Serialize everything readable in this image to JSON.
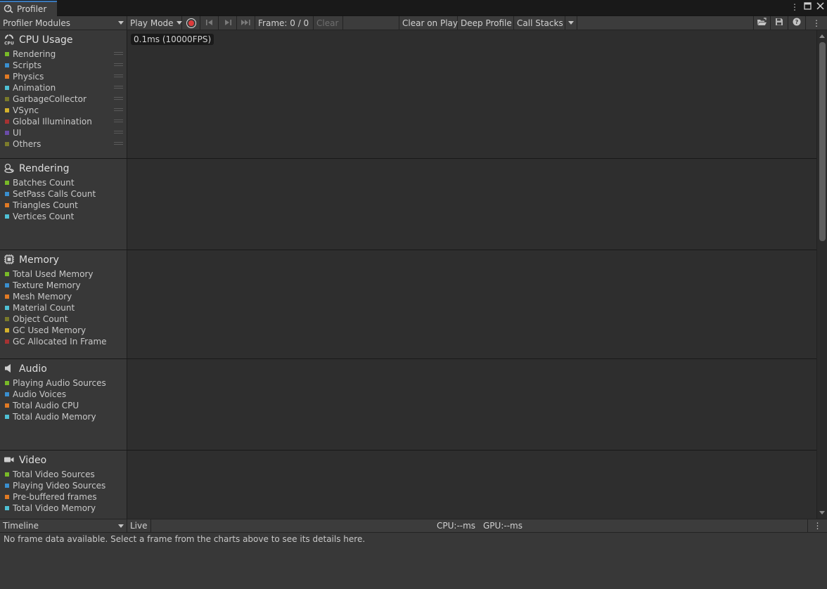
{
  "window": {
    "tab_title": "Profiler"
  },
  "toolbar": {
    "modules_dropdown": "Profiler Modules",
    "target_dropdown": "Play Mode",
    "frame": "Frame: 0 / 0",
    "clear": "Clear",
    "clear_on_play": "Clear on Play",
    "deep_profile": "Deep Profile",
    "call_stacks": "Call Stacks"
  },
  "modules": [
    {
      "title": "CPU Usage",
      "icon": "cpu-icon",
      "chart_label": "0.1ms (10000FPS)",
      "items": [
        {
          "label": "Rendering",
          "color": "#79b928"
        },
        {
          "label": "Scripts",
          "color": "#3a8fcf"
        },
        {
          "label": "Physics",
          "color": "#e07a24"
        },
        {
          "label": "Animation",
          "color": "#4fc0d4"
        },
        {
          "label": "GarbageCollector",
          "color": "#7a7a2a"
        },
        {
          "label": "VSync",
          "color": "#d4b22c"
        },
        {
          "label": "Global Illumination",
          "color": "#a63232"
        },
        {
          "label": "UI",
          "color": "#6a4ca8"
        },
        {
          "label": "Others",
          "color": "#7c7c2c"
        }
      ]
    },
    {
      "title": "Rendering",
      "icon": "rendering-icon",
      "items": [
        {
          "label": "Batches Count",
          "color": "#79b928"
        },
        {
          "label": "SetPass Calls Count",
          "color": "#3a8fcf"
        },
        {
          "label": "Triangles Count",
          "color": "#e07a24"
        },
        {
          "label": "Vertices Count",
          "color": "#4fc0d4"
        }
      ]
    },
    {
      "title": "Memory",
      "icon": "memory-chip-icon",
      "items": [
        {
          "label": "Total Used Memory",
          "color": "#79b928"
        },
        {
          "label": "Texture Memory",
          "color": "#3a8fcf"
        },
        {
          "label": "Mesh Memory",
          "color": "#e07a24"
        },
        {
          "label": "Material Count",
          "color": "#4fc0d4"
        },
        {
          "label": "Object Count",
          "color": "#7a7a2a"
        },
        {
          "label": "GC Used Memory",
          "color": "#d4b22c"
        },
        {
          "label": "GC Allocated In Frame",
          "color": "#a63232"
        }
      ]
    },
    {
      "title": "Audio",
      "icon": "speaker-icon",
      "items": [
        {
          "label": "Playing Audio Sources",
          "color": "#79b928"
        },
        {
          "label": "Audio Voices",
          "color": "#3a8fcf"
        },
        {
          "label": "Total Audio CPU",
          "color": "#e07a24"
        },
        {
          "label": "Total Audio Memory",
          "color": "#4fc0d4"
        }
      ]
    },
    {
      "title": "Video",
      "icon": "video-camera-icon",
      "items": [
        {
          "label": "Total Video Sources",
          "color": "#79b928"
        },
        {
          "label": "Playing Video Sources",
          "color": "#3a8fcf"
        },
        {
          "label": "Pre-buffered frames",
          "color": "#e07a24"
        },
        {
          "label": "Total Video Memory",
          "color": "#4fc0d4"
        }
      ]
    }
  ],
  "bottom": {
    "view_dropdown": "Timeline",
    "live": "Live",
    "cpu": "CPU:--ms",
    "gpu": "GPU:--ms",
    "message": "No frame data available. Select a frame from the charts above to see its details here."
  }
}
